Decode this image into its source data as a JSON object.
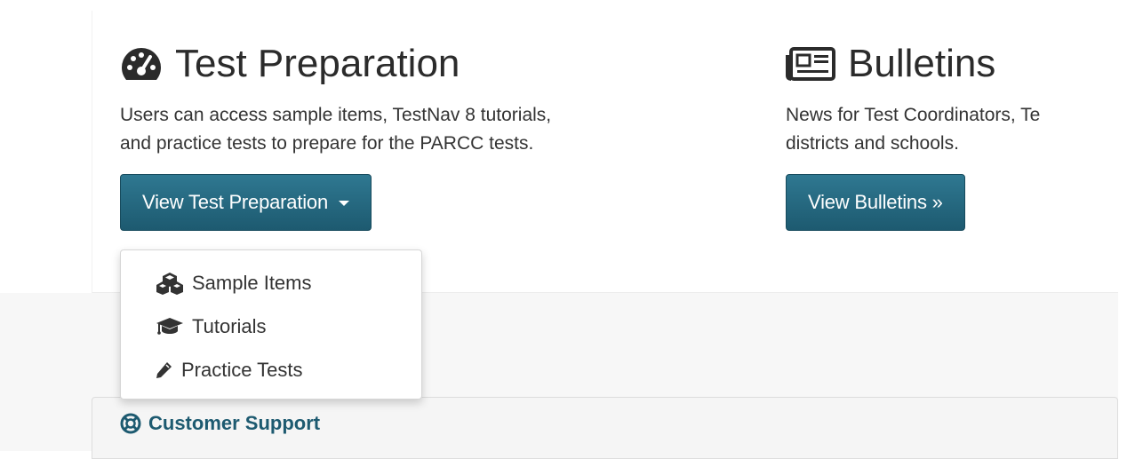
{
  "test_prep": {
    "heading": "Test Preparation",
    "description_line1": "Users can access sample items, TestNav 8 tutorials,",
    "description_line2": "and practice tests to prepare for the PARCC tests.",
    "button_label": "View Test Preparation",
    "menu": {
      "items": [
        {
          "label": "Sample Items",
          "icon": "cubes-icon"
        },
        {
          "label": "Tutorials",
          "icon": "graduation-cap-icon"
        },
        {
          "label": "Practice Tests",
          "icon": "pencil-icon"
        }
      ]
    }
  },
  "bulletins": {
    "heading": "Bulletins",
    "description_line1": "News for Test Coordinators, Te",
    "description_line2": "districts and schools.",
    "button_label": "View Bulletins »"
  },
  "support": {
    "title": "Customer Support",
    "icon": "life-ring-icon"
  },
  "colors": {
    "button_bg": "#1d5a70",
    "support_text": "#1d5a70"
  }
}
